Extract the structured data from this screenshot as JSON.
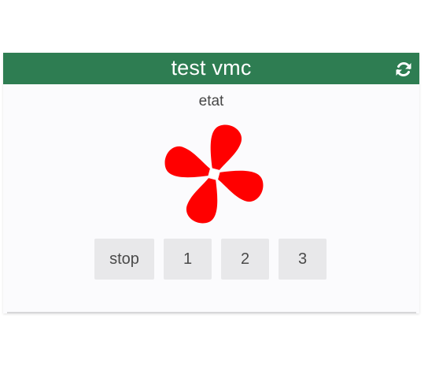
{
  "widget": {
    "title": "test vmc",
    "header_color": "#2e7d52",
    "refresh_icon": "refresh-icon",
    "command_name": "etat",
    "state_icon": "fan-icon",
    "state_color": "#ff0000"
  },
  "buttons": [
    {
      "label": "stop"
    },
    {
      "label": "1"
    },
    {
      "label": "2"
    },
    {
      "label": "3"
    }
  ]
}
